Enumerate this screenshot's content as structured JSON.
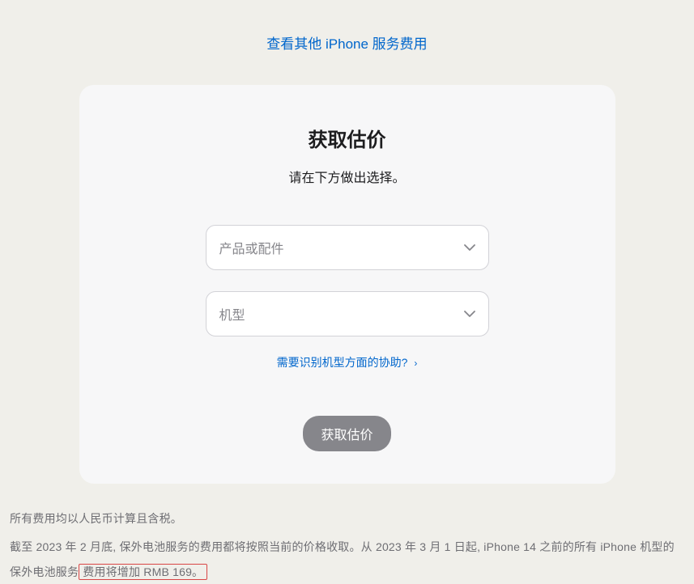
{
  "topLink": {
    "text": "查看其他 iPhone 服务费用"
  },
  "card": {
    "title": "获取估价",
    "subtitle": "请在下方做出选择。",
    "productSelect": {
      "placeholder": "产品或配件"
    },
    "modelSelect": {
      "placeholder": "机型"
    },
    "helpLink": {
      "text": "需要识别机型方面的协助?"
    },
    "button": {
      "label": "获取估价"
    }
  },
  "footer": {
    "note1": "所有费用均以人民币计算且含税。",
    "note2_pre": "截至 2023 年 2 月底, 保外电池服务的费用都将按照当前的价格收取。从 2023 年 3 月 1 日起, iPhone 14 之前的所有 iPhone 机型的保外电池服务",
    "note2_highlight": "费用将增加 RMB 169。"
  }
}
